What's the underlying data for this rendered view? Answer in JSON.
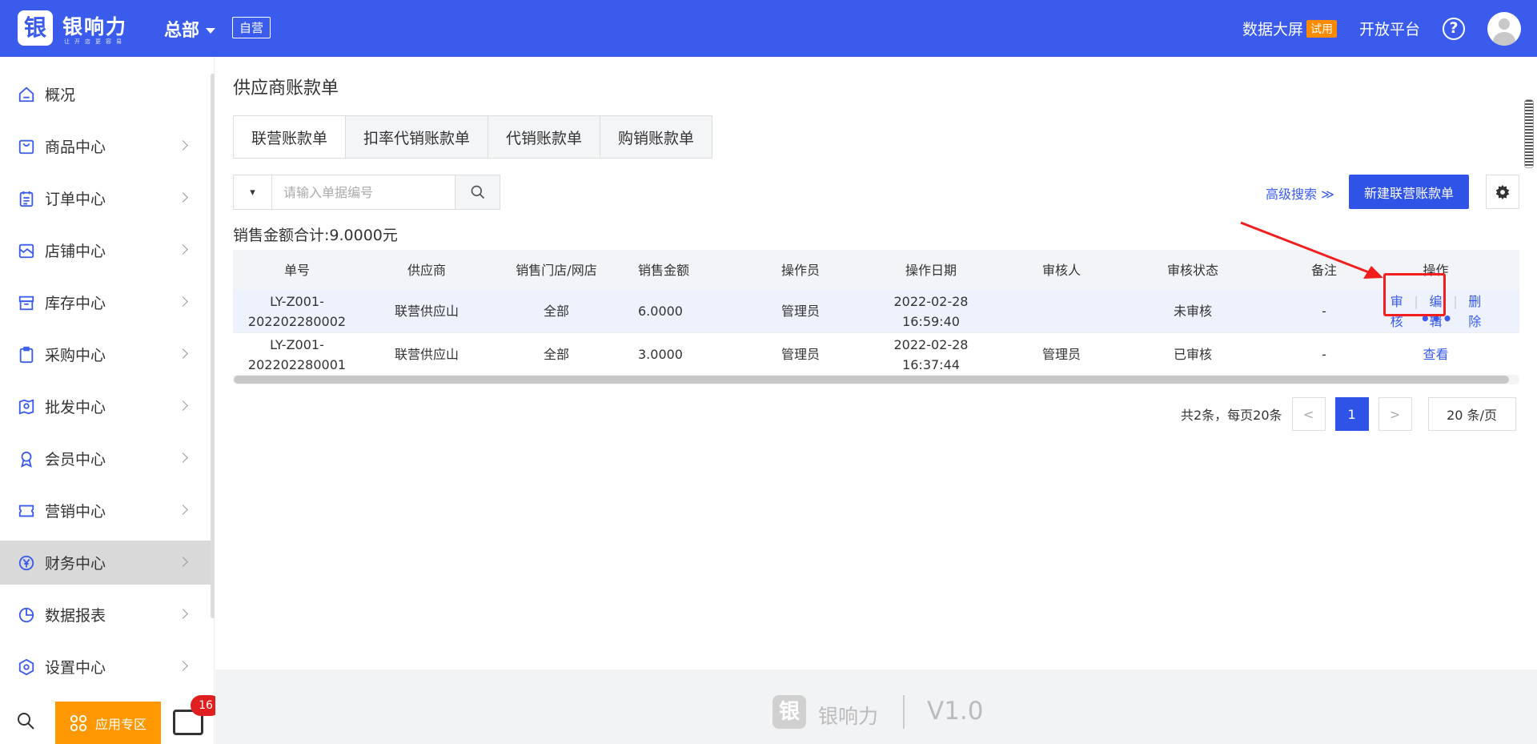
{
  "header": {
    "logo_char": "银",
    "logo_text": "银响力",
    "logo_sub": "让开店更容易",
    "org": "总部",
    "self_tag": "自营",
    "big_screen": "数据大屏",
    "trial": "试用",
    "open_platform": "开放平台",
    "help": "?"
  },
  "sidebar": {
    "items": [
      {
        "label": "概况"
      },
      {
        "label": "商品中心"
      },
      {
        "label": "订单中心"
      },
      {
        "label": "店铺中心"
      },
      {
        "label": "库存中心"
      },
      {
        "label": "采购中心"
      },
      {
        "label": "批发中心"
      },
      {
        "label": "会员中心"
      },
      {
        "label": "营销中心"
      },
      {
        "label": "财务中心"
      },
      {
        "label": "数据报表"
      },
      {
        "label": "设置中心"
      }
    ],
    "active": "财务中心",
    "app_zone": "应用专区",
    "msg_badge": "16"
  },
  "main": {
    "title": "供应商账款单",
    "tabs": [
      "联营账款单",
      "扣率代销账款单",
      "代销账款单",
      "购销账款单"
    ],
    "search_placeholder": "请输入单据编号",
    "select_arrow": "▾",
    "advanced_search": "高级搜索 ≫",
    "new_button": "新建联营账款单",
    "sum_text": "销售金额合计:9.0000元",
    "columns": [
      "单号",
      "供应商",
      "销售门店/网店",
      "销售金额",
      "操作员",
      "操作日期",
      "审核人",
      "审核状态",
      "备注",
      "操作"
    ],
    "rows": [
      {
        "no_a": "LY-Z001-",
        "no_b": "202202280002",
        "supplier": "联营供应山",
        "store": "全部",
        "amount": "6.0000",
        "operator": "管理员",
        "date": "2022-02-28",
        "time": "16:59:40",
        "auditor": "",
        "status": "未审核",
        "remark": "-",
        "ops": [
          "审核",
          "编辑",
          "删除"
        ],
        "more": "•••"
      },
      {
        "no_a": "LY-Z001-",
        "no_b": "202202280001",
        "supplier": "联营供应山",
        "store": "全部",
        "amount": "3.0000",
        "operator": "管理员",
        "date": "2022-02-28",
        "time": "16:37:44",
        "auditor": "管理员",
        "status": "已审核",
        "remark": "-",
        "ops": [
          "查看"
        ]
      }
    ],
    "pager": {
      "total": "共2条，每页20条",
      "prev": "<",
      "current": "1",
      "next": ">",
      "size": "20 条/页"
    }
  },
  "footer": {
    "logo_char": "银",
    "name": "银响力",
    "version": "V1.0"
  },
  "colors": {
    "primary": "#3a5bec",
    "orange": "#ff9800",
    "red": "#f21e1e"
  }
}
